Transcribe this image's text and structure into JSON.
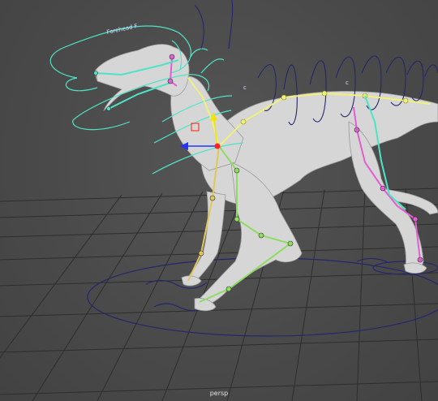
{
  "viewport": {
    "camera_label": "persp",
    "background_color": "#4b4b4b",
    "grid_color": "#2e2e2e"
  },
  "scene": {
    "subject": "quadruped dinosaur rig",
    "control_label": "Forehead F",
    "curve_marker": "c",
    "colors": {
      "mesh": "#d8d8d8",
      "cyan_controls": "#4fe3c6",
      "blue_controls": "#24276b",
      "spine_joints": "#f0f07a",
      "leg_joints_green": "#8fdc63",
      "leg_joints_pink": "#e15fd0",
      "manipulator_x": "#2233ff",
      "manipulator_y": "#f2e30d",
      "manipulator_z": "#ff3b2a"
    },
    "icons": [
      "translate-manipulator-icon",
      "pivot-icon"
    ]
  }
}
